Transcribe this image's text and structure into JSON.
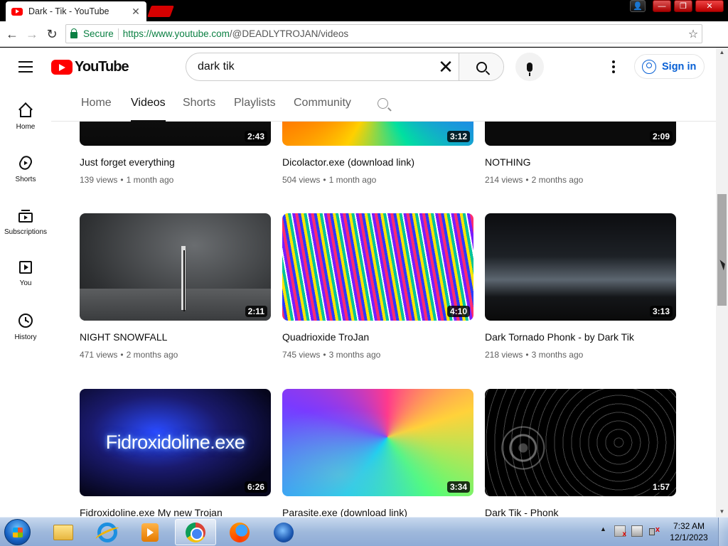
{
  "browser": {
    "tab_title": "Dark - Tik - YouTube",
    "tab_close": "✕",
    "secure_label": "Secure",
    "url_host": "https://www.youtube.com",
    "url_path": "/@DEADLYTROJAN/videos"
  },
  "youtube": {
    "logo_text": "YouTube",
    "search_value": "dark tik",
    "sign_in": "Sign in",
    "rail": [
      {
        "label": "Home",
        "icon": "home-icon"
      },
      {
        "label": "Shorts",
        "icon": "shorts-icon"
      },
      {
        "label": "Subscriptions",
        "icon": "subscriptions-icon"
      },
      {
        "label": "You",
        "icon": "you-icon"
      },
      {
        "label": "History",
        "icon": "history-icon"
      }
    ],
    "channel_tabs": [
      "Home",
      "Videos",
      "Shorts",
      "Playlists",
      "Community"
    ],
    "active_tab": "Videos",
    "videos": [
      {
        "title": "Just forget everything",
        "views": "139 views",
        "age": "1 month ago",
        "duration": "2:43"
      },
      {
        "title": "Dicolactor.exe (download link)",
        "views": "504 views",
        "age": "1 month ago",
        "duration": "3:12"
      },
      {
        "title": "NOTHING",
        "views": "214 views",
        "age": "2 months ago",
        "duration": "2:09"
      },
      {
        "title": "NIGHT SNOWFALL",
        "views": "471 views",
        "age": "2 months ago",
        "duration": "2:11"
      },
      {
        "title": "Quadrioxide TroJan",
        "views": "745 views",
        "age": "3 months ago",
        "duration": "4:10"
      },
      {
        "title": "Dark Tornado Phonk - by Dark Tik",
        "views": "218 views",
        "age": "3 months ago",
        "duration": "3:13"
      },
      {
        "title": "Fidroxidoline.exe My new Trojan",
        "views": "",
        "age": "",
        "duration": "6:26",
        "thumb_text": "Fidroxidoline.exe"
      },
      {
        "title": "Parasite.exe (download link)",
        "views": "",
        "age": "",
        "duration": "3:34"
      },
      {
        "title": "Dark Tik - Phonk",
        "views": "",
        "age": "",
        "duration": "1:57"
      }
    ]
  },
  "taskbar": {
    "time": "7:32 AM",
    "date": "12/1/2023"
  },
  "colors": {
    "youtube_red": "#ff0000",
    "link_blue": "#065fd4",
    "secure_green": "#0b8043"
  }
}
